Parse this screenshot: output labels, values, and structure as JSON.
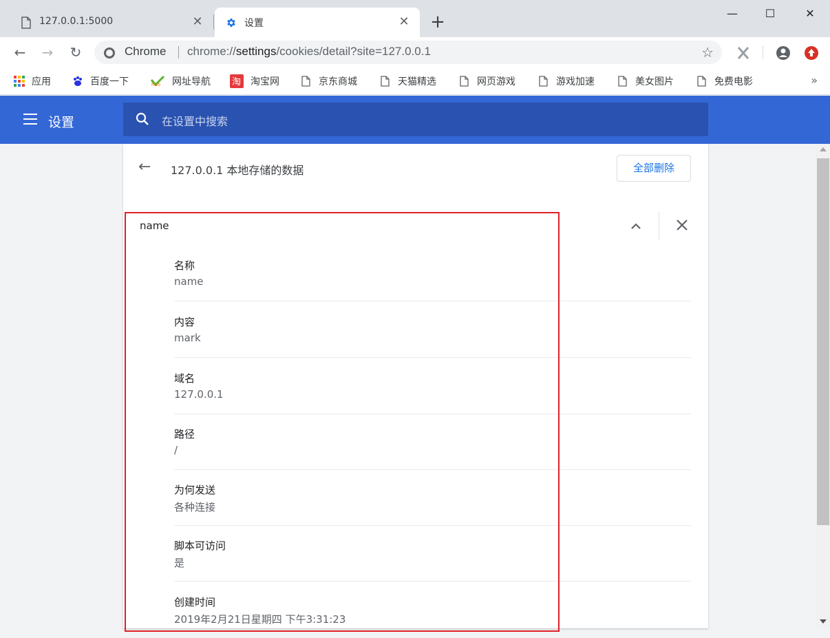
{
  "tabs": [
    {
      "title": "127.0.0.1:5000",
      "icon": "page-icon"
    },
    {
      "title": "设置",
      "icon": "gear-icon"
    }
  ],
  "window_controls": {
    "minimize": "—",
    "maximize": "☐",
    "close": "✕"
  },
  "toolbar": {
    "back": "←",
    "forward": "→",
    "reload": "↻",
    "omnibox_chip": "Chrome",
    "url_prefix": "chrome://",
    "url_host": "settings",
    "url_path": "/cookies/detail?site=127.0.0.1"
  },
  "bookmarks": [
    {
      "label": "应用",
      "icon": "apps-grid-icon"
    },
    {
      "label": "百度一下",
      "icon": "baidu-paw-icon"
    },
    {
      "label": "网址导航",
      "icon": "hao-icon"
    },
    {
      "label": "淘宝网",
      "icon": "taobao-icon"
    },
    {
      "label": "京东商城",
      "icon": "page-icon"
    },
    {
      "label": "天猫精选",
      "icon": "page-icon"
    },
    {
      "label": "网页游戏",
      "icon": "page-icon"
    },
    {
      "label": "游戏加速",
      "icon": "page-icon"
    },
    {
      "label": "美女图片",
      "icon": "page-icon"
    },
    {
      "label": "免费电影",
      "icon": "page-icon"
    }
  ],
  "bookmarks_more": "»",
  "settings": {
    "title": "设置",
    "search_placeholder": "在设置中搜索"
  },
  "detail": {
    "title": "127.0.0.1 本地存储的数据",
    "remove_all": "全部删除",
    "cookie_name": "name",
    "fields": [
      {
        "label": "名称",
        "value": "name"
      },
      {
        "label": "内容",
        "value": "mark"
      },
      {
        "label": "域名",
        "value": "127.0.0.1"
      },
      {
        "label": "路径",
        "value": "/"
      },
      {
        "label": "为何发送",
        "value": "各种连接"
      },
      {
        "label": "脚本可访问",
        "value": "是"
      },
      {
        "label": "创建时间",
        "value": "2019年2月21日星期四 下午3:31:23"
      }
    ]
  },
  "colors": {
    "accent": "#3367d6",
    "highlight": "#e0202a",
    "link": "#1a73e8"
  }
}
